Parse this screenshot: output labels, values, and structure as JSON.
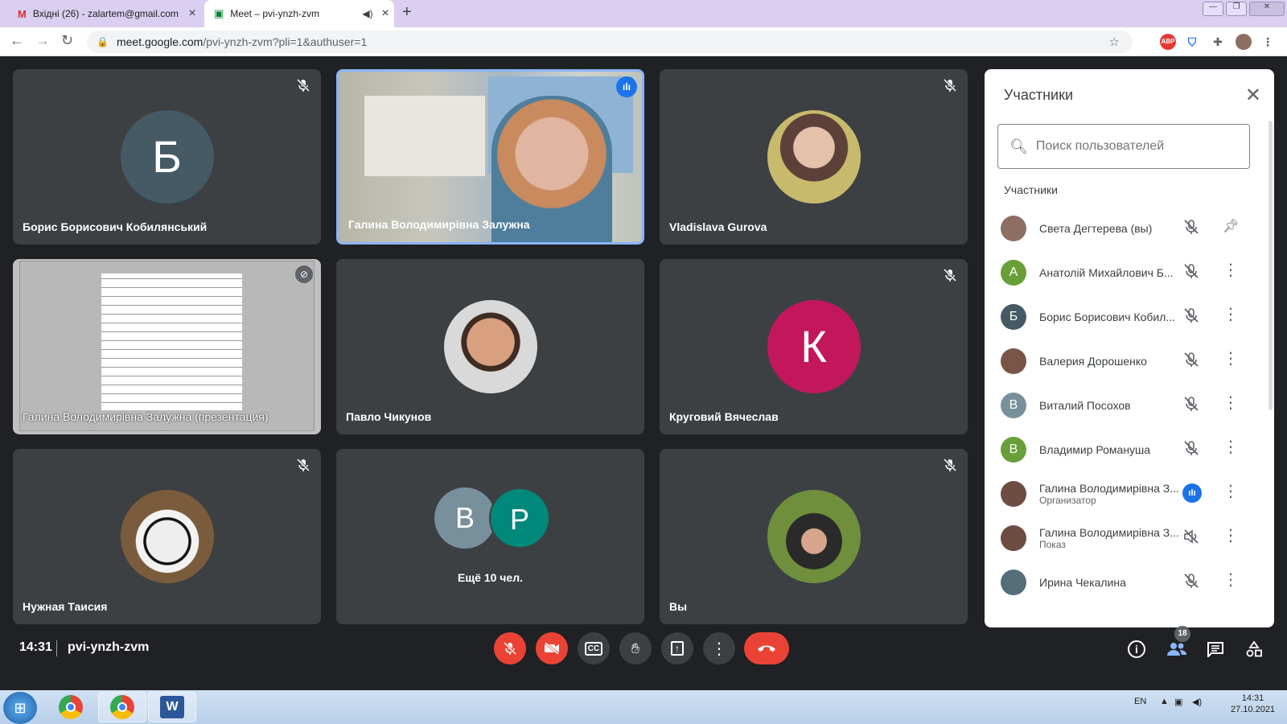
{
  "browser": {
    "tabs": [
      {
        "favicon": "gmail-icon",
        "title": "Вхідні (26) - zalartem@gmail.com"
      },
      {
        "favicon": "meet-icon",
        "title": "Meet – pvi-ynzh-zvm"
      }
    ],
    "url_host": "meet.google.com",
    "url_path": "/pvi-ynzh-zvm?pli=1&authuser=1",
    "extensions": [
      "abp-icon",
      "shield-icon",
      "puzzle-icon",
      "profile-avatar"
    ]
  },
  "tiles": [
    {
      "name": "Борис Борисович Кобилянський",
      "initial": "Б",
      "color": "#455a64",
      "muted": true
    },
    {
      "name": "Галина Володимирівна Залужна",
      "speaking": true
    },
    {
      "name": "Vladislava Gurova",
      "muted": true
    },
    {
      "name": "Галина Володимирівна Залужна (презентация)"
    },
    {
      "name": "Павло Чикунов"
    },
    {
      "name": "Круговий Вячеслав",
      "initial": "К",
      "color": "#c2185b",
      "muted": true
    },
    {
      "name": "Нужная Таисия",
      "muted": true
    },
    {
      "more_label": "Ещё 10 чел.",
      "initials": [
        "В",
        "Р"
      ],
      "colors": [
        "#78909c",
        "#00897b"
      ]
    },
    {
      "name": "Вы",
      "muted": true
    }
  ],
  "panel": {
    "title": "Участники",
    "search_placeholder": "Поиск пользователей",
    "section": "Участники",
    "participants": [
      {
        "name": "Света Дегтерева (вы)",
        "initial": "",
        "color": "#8d6e63",
        "status": "",
        "action": "pin"
      },
      {
        "name": "Анатолій Михайлович Б...",
        "initial": "А",
        "color": "#689f38",
        "status": ""
      },
      {
        "name": "Борис Борисович Кобил...",
        "initial": "Б",
        "color": "#455a64",
        "status": ""
      },
      {
        "name": "Валерия Дорошенко",
        "initial": "",
        "color": "#795548",
        "status": ""
      },
      {
        "name": "Виталий Посохов",
        "initial": "В",
        "color": "#78909c",
        "status": ""
      },
      {
        "name": "Владимир Романуша",
        "initial": "В",
        "color": "#689f38",
        "status": ""
      },
      {
        "name": "Галина Володимирівна З...",
        "initial": "",
        "color": "#6d4c41",
        "status": "Организатор",
        "speaking": true
      },
      {
        "name": "Галина Володимирівна З...",
        "initial": "",
        "color": "#6d4c41",
        "status": "Показ",
        "sound_off": true
      },
      {
        "name": "Ирина Чекалина",
        "initial": "",
        "color": "#546e7a",
        "status": ""
      }
    ]
  },
  "bottom": {
    "time": "14:31",
    "meeting_code": "pvi-ynzh-zvm",
    "participant_count": "18"
  },
  "taskbar": {
    "lang": "EN",
    "time": "14:31",
    "date": "27.10.2021"
  }
}
